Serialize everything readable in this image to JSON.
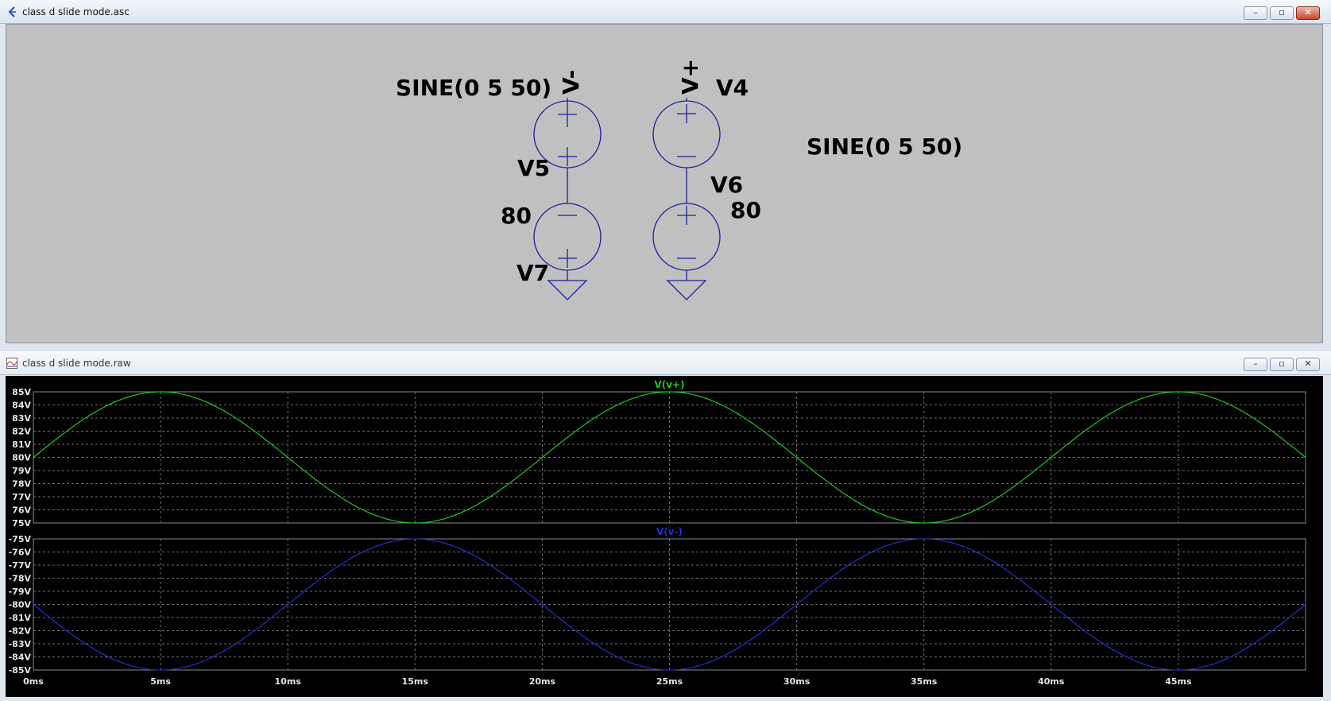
{
  "schematic_window": {
    "title": "class d slide mode.asc",
    "buttons": [
      "–",
      "▫",
      "✕"
    ],
    "labels": {
      "v5_value": "SINE(0 5 50)",
      "v4_value": "SINE(0 5 50)",
      "v5_name": "V5",
      "v4_name": "V4",
      "v7_name": "V7",
      "v6_name": "V6",
      "v7_value": "80",
      "v6_value": "80",
      "net_minus": "V-",
      "net_plus": "V+"
    }
  },
  "waveform_window": {
    "title": "class d slide mode.raw",
    "buttons": [
      "–",
      "▫",
      "✕"
    ]
  },
  "chart_data": [
    {
      "type": "line",
      "title": "V(v+)",
      "series": [
        {
          "name": "V(v+)",
          "color": "#1fc81f",
          "function": "80 + 5*sin(2*pi*50*t)"
        }
      ],
      "y_ticks": [
        "85V",
        "84V",
        "83V",
        "82V",
        "81V",
        "80V",
        "79V",
        "78V",
        "77V",
        "76V",
        "75V"
      ],
      "ylim": [
        75,
        85
      ],
      "x_ticks": [
        "0ms",
        "5ms",
        "10ms",
        "15ms",
        "20ms",
        "25ms",
        "30ms",
        "35ms",
        "40ms",
        "45ms"
      ],
      "xlim_ms": [
        0,
        50
      ],
      "grid": true
    },
    {
      "type": "line",
      "title": "V(v-)",
      "series": [
        {
          "name": "V(v-)",
          "color": "#2b2bd0",
          "function": "-80 - 5*sin(2*pi*50*t)"
        }
      ],
      "y_ticks": [
        "-75V",
        "-76V",
        "-77V",
        "-78V",
        "-79V",
        "-80V",
        "-81V",
        "-82V",
        "-83V",
        "-84V",
        "-85V"
      ],
      "ylim": [
        -85,
        -75
      ],
      "x_ticks": [
        "0ms",
        "5ms",
        "10ms",
        "15ms",
        "20ms",
        "25ms",
        "30ms",
        "35ms",
        "40ms",
        "45ms"
      ],
      "xlim_ms": [
        0,
        50
      ],
      "grid": true
    }
  ]
}
